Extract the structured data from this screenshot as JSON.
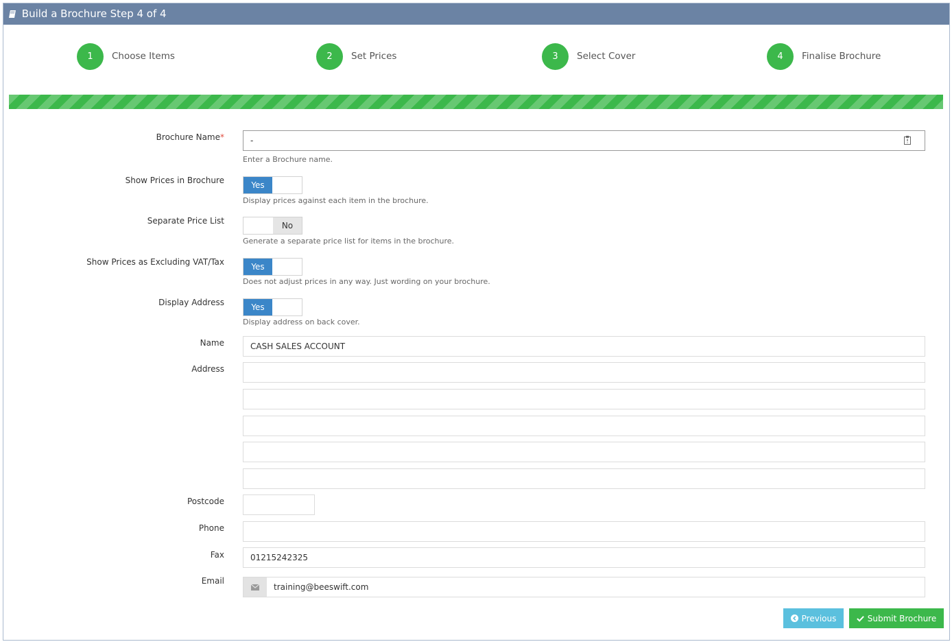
{
  "header": {
    "title": "Build a Brochure Step 4 of 4",
    "icon": "book-icon"
  },
  "steps": [
    {
      "number": "1",
      "label": "Choose Items"
    },
    {
      "number": "2",
      "label": "Set Prices"
    },
    {
      "number": "3",
      "label": "Select Cover"
    },
    {
      "number": "4",
      "label": "Finalise Brochure"
    }
  ],
  "progress_percent": 100,
  "colors": {
    "header": "#6b83a4",
    "accent_green": "#3cb84b",
    "toggle_blue": "#3b86c8",
    "prev_button": "#5bc0de"
  },
  "form": {
    "brochure_name": {
      "label": "Brochure Name",
      "required_mark": "*",
      "value": "-",
      "help": "Enter a Brochure name."
    },
    "show_prices": {
      "label": "Show Prices in Brochure",
      "state": "Yes",
      "help": "Display prices against each item in the brochure."
    },
    "separate_price_list": {
      "label": "Separate Price List",
      "state": "No",
      "help": "Generate a separate price list for items in the brochure."
    },
    "excluding_vat": {
      "label": "Show Prices as Excluding VAT/Tax",
      "state": "Yes",
      "help": "Does not adjust prices in any way. Just wording on your brochure."
    },
    "display_address": {
      "label": "Display Address",
      "state": "Yes",
      "help": "Display address on back cover."
    },
    "name": {
      "label": "Name",
      "value": "CASH SALES ACCOUNT"
    },
    "address": {
      "label": "Address",
      "lines": [
        "",
        "",
        "",
        "",
        ""
      ]
    },
    "postcode": {
      "label": "Postcode",
      "value": ""
    },
    "phone": {
      "label": "Phone",
      "value": ""
    },
    "fax": {
      "label": "Fax",
      "value": "01215242325"
    },
    "email": {
      "label": "Email",
      "value": "training@beeswift.com",
      "icon": "envelope-icon"
    }
  },
  "buttons": {
    "previous": {
      "label": "Previous",
      "icon": "arrow-left-circle-icon"
    },
    "submit": {
      "label": "Submit Brochure",
      "icon": "check-icon"
    }
  }
}
